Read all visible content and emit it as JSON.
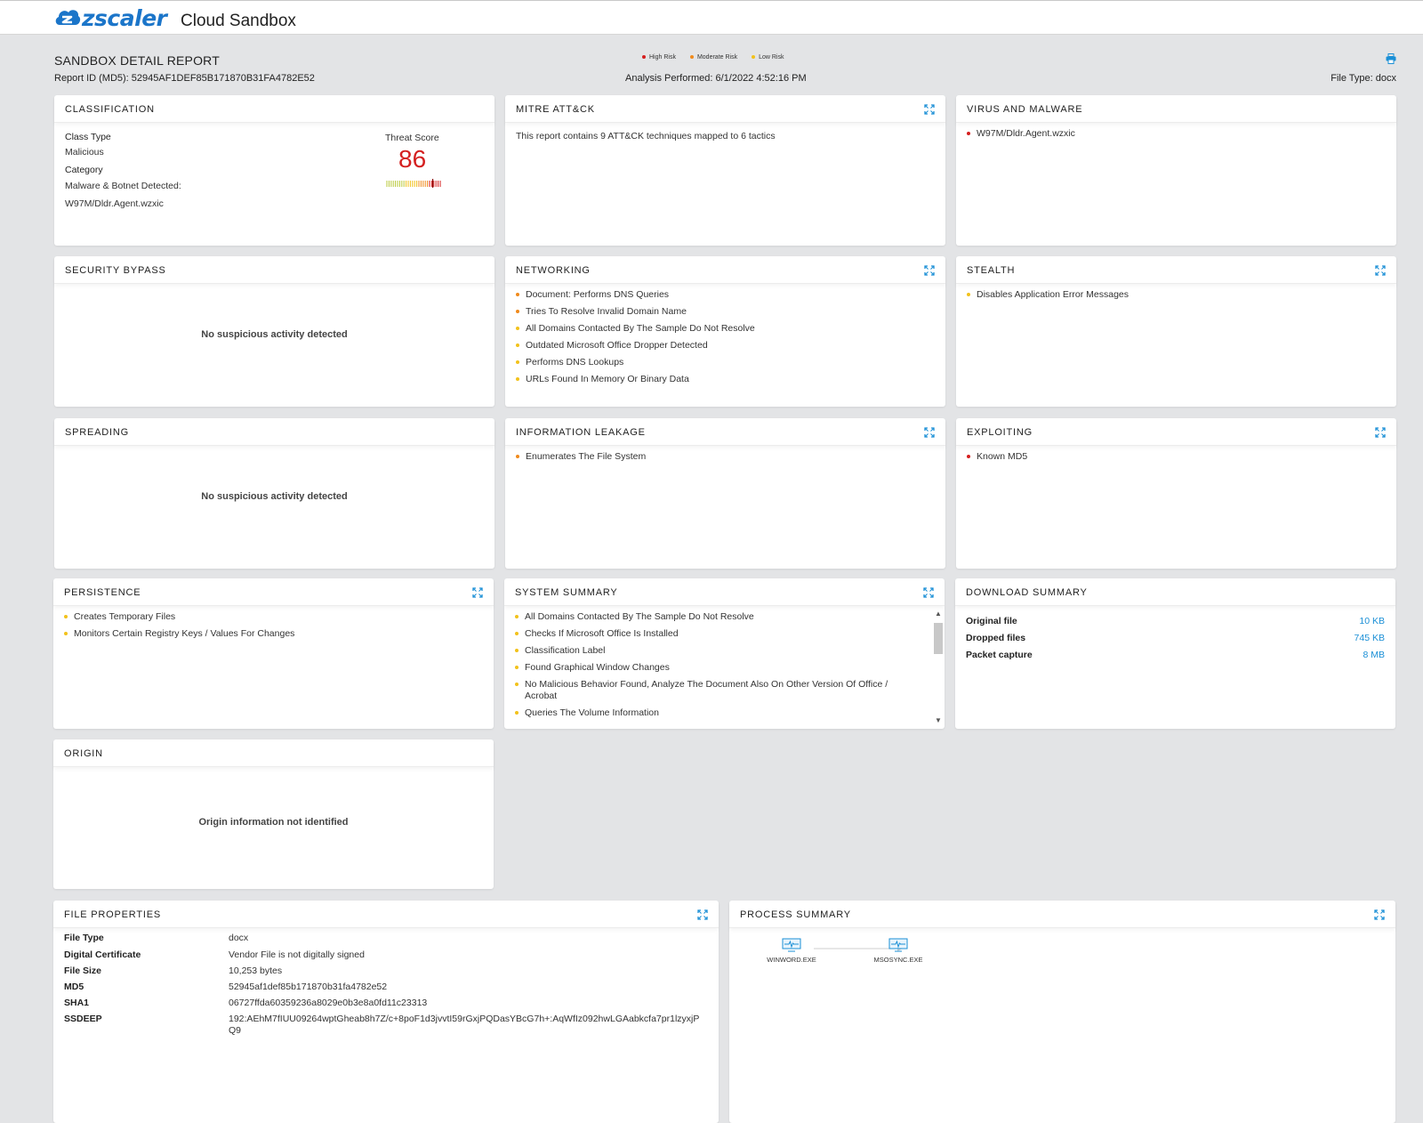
{
  "header": {
    "logo_text": "zscaler",
    "app_title": "Cloud Sandbox"
  },
  "report": {
    "title": "SANDBOX DETAIL REPORT",
    "report_id": "Report ID (MD5): 52945AF1DEF85B171870B31FA4782E52",
    "analysis": "Analysis Performed: 6/1/2022 4:52:16 PM",
    "file_type": "File Type: docx",
    "legend": [
      {
        "label": "High Risk",
        "color": "#d51f1f"
      },
      {
        "label": "Moderate Risk",
        "color": "#f08a1c"
      },
      {
        "label": "Low Risk",
        "color": "#f2c21b"
      }
    ]
  },
  "classification": {
    "title": "CLASSIFICATION",
    "class_type_label": "Class Type",
    "class_type": "Malicious",
    "category_label": "Category",
    "category": "Malware & Botnet Detected:",
    "detected_name": "W97M/Dldr.Agent.wzxic",
    "threat_score_label": "Threat Score",
    "threat_score": "86"
  },
  "mitre": {
    "title": "MITRE ATT&CK",
    "text": "This report contains 9 ATT&CK techniques mapped to 6 tactics"
  },
  "virus": {
    "title": "VIRUS AND MALWARE",
    "items": [
      "W97M/Dldr.Agent.wzxic"
    ]
  },
  "security_bypass": {
    "title": "SECURITY BYPASS",
    "message": "No suspicious activity detected"
  },
  "networking": {
    "title": "NETWORKING",
    "items": [
      "Document: Performs DNS Queries",
      "Tries To Resolve Invalid Domain Name",
      "All Domains Contacted By The Sample Do Not Resolve",
      "Outdated Microsoft Office Dropper Detected",
      "Performs DNS Lookups",
      "URLs Found In Memory Or Binary Data"
    ]
  },
  "stealth": {
    "title": "STEALTH",
    "items": [
      "Disables Application Error Messages"
    ]
  },
  "spreading": {
    "title": "SPREADING",
    "message": "No suspicious activity detected"
  },
  "info_leakage": {
    "title": "INFORMATION LEAKAGE",
    "items": [
      "Enumerates The File System"
    ]
  },
  "exploiting": {
    "title": "EXPLOITING",
    "items": [
      "Known MD5"
    ]
  },
  "persistence": {
    "title": "PERSISTENCE",
    "items": [
      "Creates Temporary Files",
      "Monitors Certain Registry Keys / Values For Changes"
    ]
  },
  "system_summary": {
    "title": "SYSTEM SUMMARY",
    "items": [
      "All Domains Contacted By The Sample Do Not Resolve",
      "Checks If Microsoft Office Is Installed",
      "Classification Label",
      "Found Graphical Window Changes",
      "No Malicious Behavior Found, Analyze The Document Also On Other Version Of Office / Acrobat",
      "Queries The Volume Information"
    ]
  },
  "download_summary": {
    "title": "DOWNLOAD SUMMARY",
    "rows": [
      {
        "label": "Original file",
        "value": "10 KB"
      },
      {
        "label": "Dropped files",
        "value": "745 KB"
      },
      {
        "label": "Packet capture",
        "value": "8 MB"
      }
    ]
  },
  "origin": {
    "title": "ORIGIN",
    "message": "Origin information not identified"
  },
  "file_properties": {
    "title": "FILE PROPERTIES",
    "rows": [
      {
        "key": "File Type",
        "value": "docx"
      },
      {
        "key": "Digital Certificate",
        "value": "Vendor  File is not digitally signed"
      },
      {
        "key": "File Size",
        "value": "10,253 bytes"
      },
      {
        "key": "MD5",
        "value": "52945af1def85b171870b31fa4782e52"
      },
      {
        "key": "SHA1",
        "value": "06727ffda60359236a8029e0b3e8a0fd11c23313"
      },
      {
        "key": "SSDEEP",
        "value": "192:AEhM7fIUU09264wptGheab8h7Z/c+8poF1d3jvvtI59rGxjPQDasYBcG7h+:AqWfIz092hwLGAabkcfa7pr1lzyxjPQ9"
      }
    ]
  },
  "process_summary": {
    "title": "PROCESS SUMMARY",
    "nodes": [
      "WINWORD.EXE",
      "MSOSYNC.EXE"
    ]
  }
}
